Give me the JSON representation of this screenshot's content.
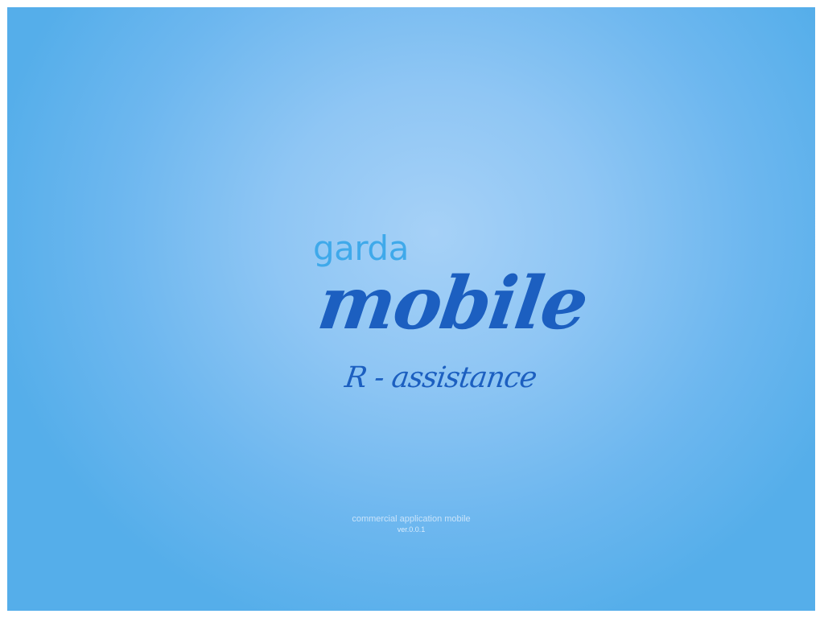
{
  "splash": {
    "brand_top": "garda",
    "brand_main": "mobile",
    "brand_sub": "R - assistance",
    "tagline": "commercial application mobile",
    "version": "ver.0.0.1"
  },
  "colors": {
    "background_center": "#a6d1f7",
    "background_edge": "#55aeea",
    "brand_light": "#3fa9ea",
    "brand_dark": "#1c5fc0",
    "footer_text": "#c9e3fa"
  }
}
